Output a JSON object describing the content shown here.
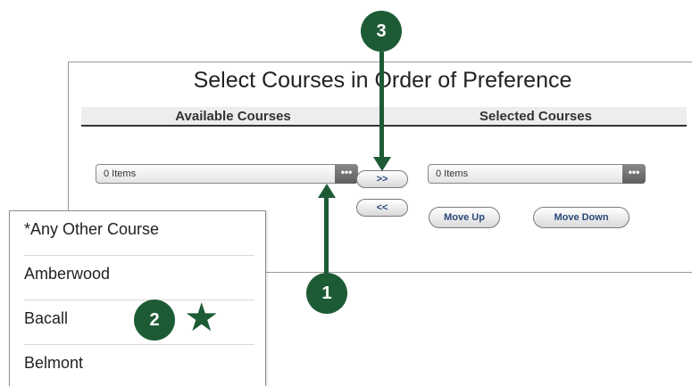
{
  "panel": {
    "title": "Select Courses in Order of Preference",
    "available_header": "Available Courses",
    "selected_header": "Selected Courses"
  },
  "available_dropdown": {
    "value": "0 Items",
    "button": "•••"
  },
  "selected_dropdown": {
    "value": "0 Items",
    "button": "•••"
  },
  "transfer": {
    "add_label": ">>",
    "remove_label": "<<"
  },
  "reorder": {
    "up_label": "Move Up",
    "down_label": "Move Down"
  },
  "popup": {
    "items": [
      "*Any Other Course",
      "Amberwood",
      "Bacall",
      "Belmont"
    ]
  },
  "callouts": {
    "one": "1",
    "two": "2",
    "three": "3",
    "star_glyph": "★"
  },
  "colors": {
    "callout": "#1d5b35"
  }
}
